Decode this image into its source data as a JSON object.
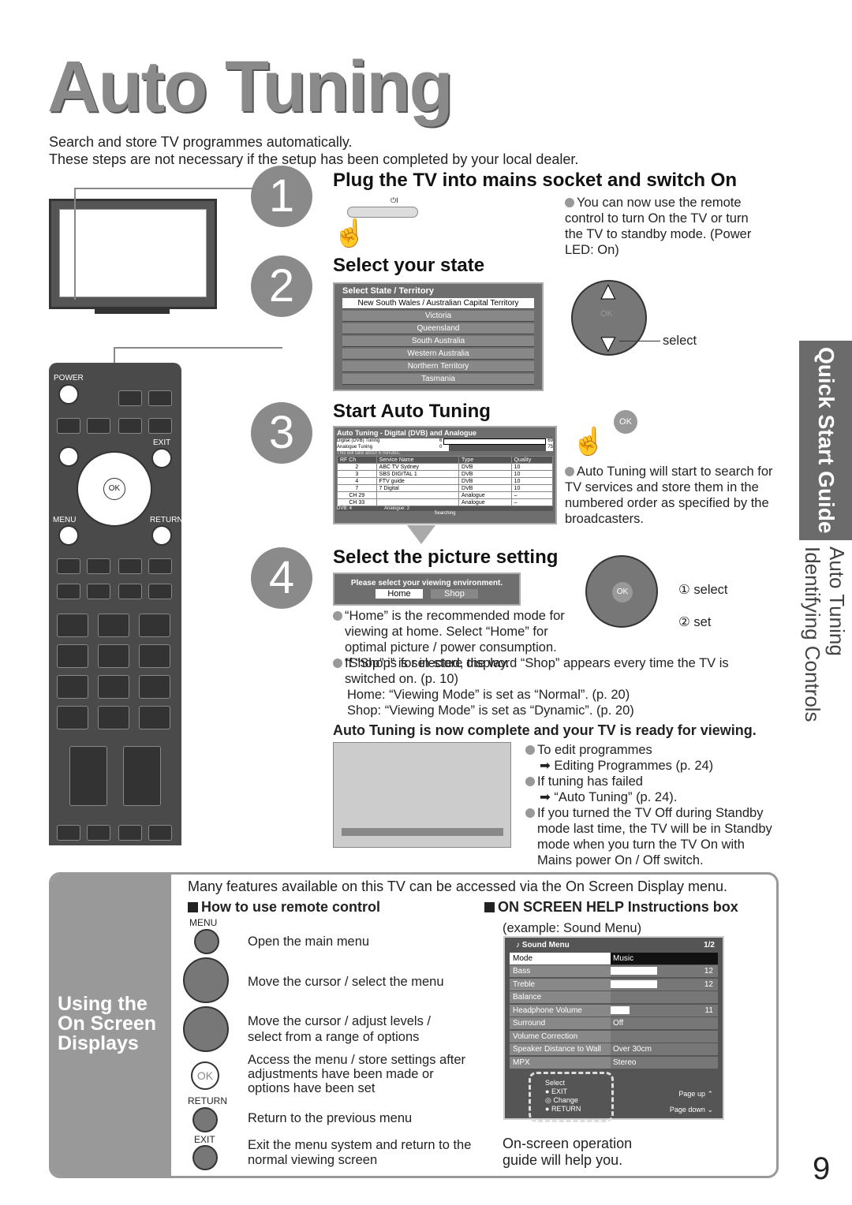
{
  "title": "Auto Tuning",
  "intro": [
    "Search and store TV programmes automatically.",
    "These steps are not necessary if the setup has been completed by your local dealer."
  ],
  "side_tab": {
    "label": "Quick Start Guide",
    "sub1": "Auto Tuning",
    "sub2": "Identifying Controls"
  },
  "page_number": "9",
  "remote": {
    "power": "POWER",
    "exit": "EXIT",
    "menu": "MENU",
    "return": "RETURN",
    "ok": "OK"
  },
  "steps": [
    {
      "num": "1",
      "heading": "Plug the TV into mains socket and switch On",
      "note": "You can now use the remote control to turn On the TV or turn the TV to standby mode. (Power LED: On)",
      "power_symbol": "⏻I"
    },
    {
      "num": "2",
      "heading": "Select your state",
      "osd_title": "Select State / Territory",
      "states": [
        "New South Wales / Australian Capital Territory",
        "Victoria",
        "Queensland",
        "South Australia",
        "Western Australia",
        "Northern Territory",
        "Tasmania"
      ],
      "select_label": "select",
      "ok": "OK"
    },
    {
      "num": "3",
      "heading": "Start Auto Tuning",
      "ok": "OK",
      "note": "Auto Tuning will start to search for TV services and store them in the numbered order as specified by the broadcasters.",
      "osd": {
        "title": "Auto Tuning - Digital (DVB) and Analogue",
        "digital_label": "Digital (DVB) Tuning",
        "digital_value": "6",
        "digital_max": "69",
        "digital_progress": 0.09,
        "analogue_label": "Analogue Tuning",
        "analogue_value": "0",
        "analogue_max": "75",
        "analogue_progress": 0.05,
        "time_note": "This will take about 6 minutes.",
        "columns": [
          "RF Ch",
          "Service Name",
          "Type",
          "Quality"
        ],
        "rows": [
          [
            "2",
            "ABC TV Sydney",
            "DVB",
            "10"
          ],
          [
            "3",
            "SBS DIGITAL 1",
            "DVB",
            "10"
          ],
          [
            "4",
            "FTV guide",
            "DVB",
            "10"
          ],
          [
            "7",
            "7 Digital",
            "DVB",
            "10"
          ],
          [
            "CH 29",
            "",
            "Analogue",
            "–"
          ],
          [
            "CH 33",
            "",
            "Analogue",
            "–"
          ]
        ],
        "dvb_count": "DVB: 4",
        "analogue_count": "Analogue: 2",
        "status": "Searching"
      }
    },
    {
      "num": "4",
      "heading": "Select the picture setting",
      "osd_title": "Please select your viewing environment.",
      "options": [
        "Home",
        "Shop"
      ],
      "select_label": "select",
      "set_label": "set",
      "ok": "OK",
      "notes": [
        "“Home” is the recommended mode for viewing at home. Select “Home” for optimal picture / power consumption. “Shop” is for in-store display.",
        "If “Shop” is selected, the word “Shop” appears every time the TV is switched on. (p. 10)"
      ],
      "home_line": "Home:  “Viewing Mode” is set as “Normal”. (p. 20)",
      "shop_line": "Shop:  “Viewing Mode” is set as “Dynamic”. (p. 20)"
    }
  ],
  "complete": {
    "heading": "Auto Tuning is now complete and your TV is ready for viewing.",
    "items": [
      {
        "text": "To edit programmes",
        "ref": "Editing Programmes (p. 24)"
      },
      {
        "text": "If tuning has failed",
        "ref": "“Auto Tuning” (p. 24)."
      },
      {
        "text": "If you turned the TV Off during Standby mode last time, the TV will be in Standby mode when you turn the TV On with Mains power On / Off switch.",
        "ref": ""
      }
    ]
  },
  "osd_section": {
    "side_title": "Using the On Screen Displays",
    "intro": "Many features available on this TV can be accessed via the On Screen Display menu.",
    "remote_heading": "How to use remote control",
    "help_heading": "ON SCREEN HELP Instructions box",
    "controls": [
      {
        "label": "MENU",
        "desc": "Open the main menu"
      },
      {
        "label": "",
        "desc": "Move the cursor / select the menu"
      },
      {
        "label": "",
        "desc": "Move the cursor / adjust levels / select from a range of options"
      },
      {
        "label": "OK",
        "desc": "Access the menu / store settings after adjustments have been made or options have been set"
      },
      {
        "label": "RETURN",
        "desc": "Return to the previous menu"
      },
      {
        "label": "EXIT",
        "desc": "Exit the menu system and return to the normal viewing screen"
      }
    ],
    "example": "(example: Sound Menu)",
    "sound_menu": {
      "title": "Sound Menu",
      "page": "1/2",
      "rows": [
        {
          "label": "Mode",
          "value": "Music"
        },
        {
          "label": "Bass",
          "value": "12",
          "level": 0.6
        },
        {
          "label": "Treble",
          "value": "12",
          "level": 0.6
        },
        {
          "label": "Balance",
          "value": ""
        },
        {
          "label": "Headphone Volume",
          "value": "11",
          "level": 0.25
        },
        {
          "label": "Surround",
          "value": "Off"
        },
        {
          "label": "Volume Correction",
          "value": ""
        },
        {
          "label": "Speaker Distance to Wall",
          "value": "Over 30cm"
        },
        {
          "label": "MPX",
          "value": "Stereo"
        }
      ],
      "help": {
        "select": "Select",
        "exit": "EXIT",
        "change": "Change",
        "return": "RETURN",
        "page_up": "Page up",
        "page_down": "Page down"
      }
    },
    "footer": "On-screen operation guide will help you."
  }
}
